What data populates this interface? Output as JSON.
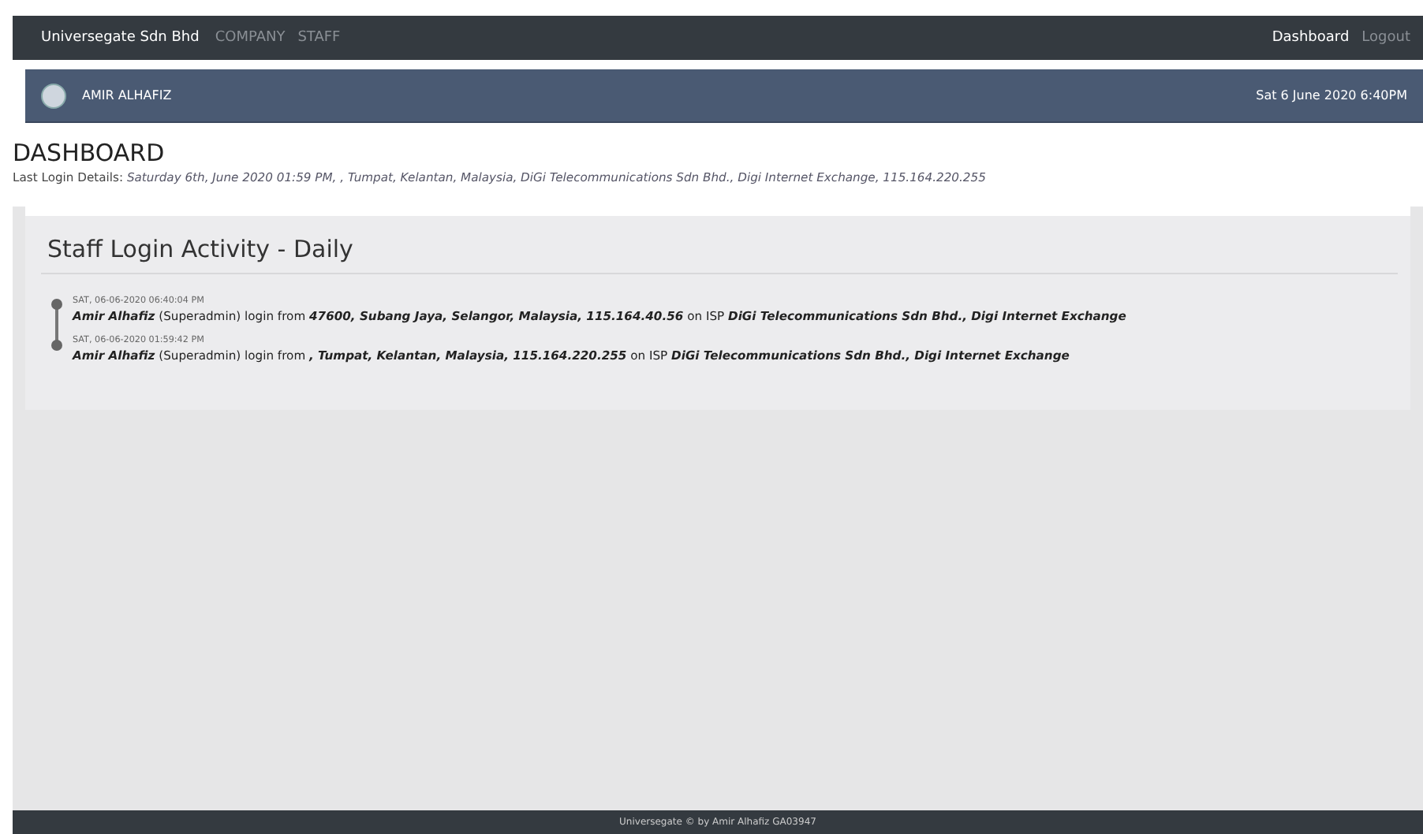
{
  "navbar": {
    "brand": "Universegate Sdn Bhd",
    "links": [
      {
        "label": "COMPANY"
      },
      {
        "label": "STAFF"
      }
    ],
    "right_links": [
      {
        "label": "Dashboard",
        "selected": true
      },
      {
        "label": "Logout",
        "selected": false
      }
    ]
  },
  "user_bar": {
    "name": "AMIR ALHAFIZ",
    "datetime": "Sat 6 June 2020 6:40PM"
  },
  "page_title": "DASHBOARD",
  "last_login": {
    "label": "Last Login Details:",
    "value": "Saturday 6th, June 2020 01:59 PM, , Tumpat, Kelantan, Malaysia, DiGi Telecommunications Sdn Bhd., Digi Internet Exchange, 115.164.220.255"
  },
  "activity": {
    "title": "Staff Login Activity - Daily",
    "entries": [
      {
        "time": "SAT, 06-06-2020 06:40:04 PM",
        "user": "Amir Alhafiz",
        "role": "(Superadmin) login from",
        "location": "47600, Subang Jaya, Selangor, Malaysia, 115.164.40.56",
        "isp_label": "on ISP",
        "isp": "DiGi Telecommunications Sdn Bhd., Digi Internet Exchange"
      },
      {
        "time": "SAT, 06-06-2020 01:59:42 PM",
        "user": "Amir Alhafiz",
        "role": "(Superadmin) login from",
        "location": ", Tumpat, Kelantan, Malaysia, 115.164.220.255",
        "isp_label": "on ISP",
        "isp": "DiGi Telecommunications Sdn Bhd., Digi Internet Exchange"
      }
    ]
  },
  "footer": "Universegate © by Amir Alhafiz GA03947"
}
